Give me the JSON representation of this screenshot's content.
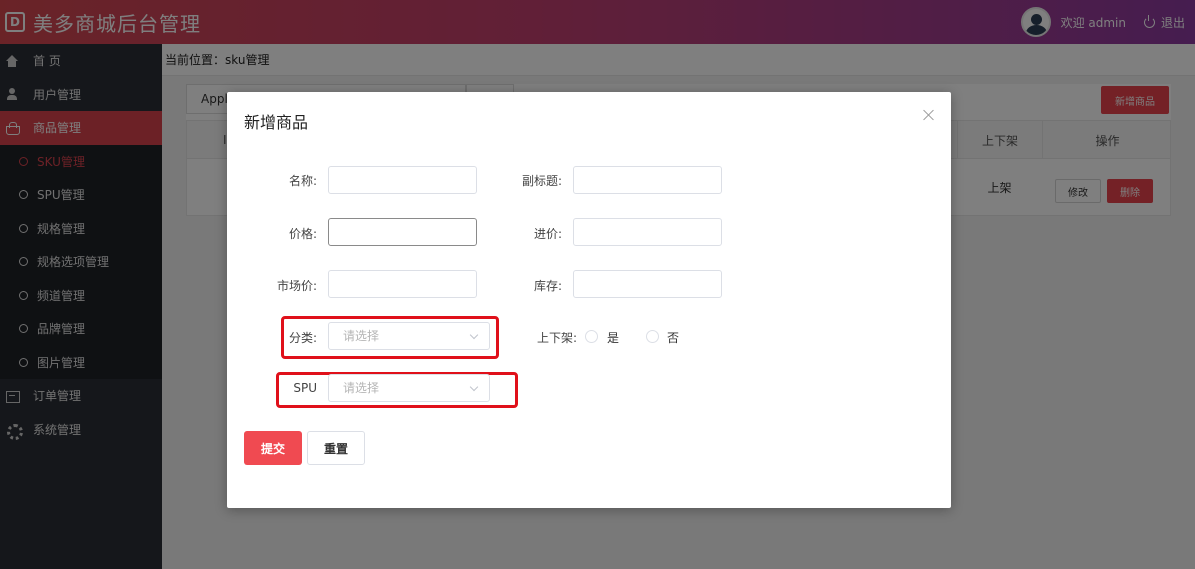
{
  "header": {
    "logo_glyph": "D",
    "title": "美多商城后台管理",
    "welcome": "欢迎 admin",
    "logout": "退出"
  },
  "sidebar": {
    "items": [
      {
        "label": "首 页",
        "icon": "home-icon"
      },
      {
        "label": "用户管理",
        "icon": "user-icon"
      },
      {
        "label": "商品管理",
        "icon": "basket-icon"
      },
      {
        "label": "订单管理",
        "icon": "list-icon"
      },
      {
        "label": "系统管理",
        "icon": "gear-icon"
      }
    ],
    "sub_items": [
      {
        "label": "SKU管理"
      },
      {
        "label": "SPU管理"
      },
      {
        "label": "规格管理"
      },
      {
        "label": "规格选项管理"
      },
      {
        "label": "频道管理"
      },
      {
        "label": "品牌管理"
      },
      {
        "label": "图片管理"
      }
    ]
  },
  "main": {
    "breadcrumb": "当前位置：sku管理",
    "search_value": "Apple",
    "new_button": "新增商品",
    "table": {
      "headers": {
        "status": "上下架",
        "operation": "操作"
      },
      "rows": [
        {
          "status": "上架",
          "edit": "修改",
          "delete": "删除"
        }
      ]
    }
  },
  "dialog": {
    "title": "新增商品",
    "fields": {
      "name_label": "名称:",
      "subtitle_label": "副标题:",
      "price_label": "价格:",
      "cost_label": "进价:",
      "market_label": "市场价:",
      "stock_label": "库存:",
      "category_label": "分类:",
      "category_placeholder": "请选择",
      "onsale_label": "上下架:",
      "onsale_yes": "是",
      "onsale_no": "否",
      "spu_label": "SPU",
      "spu_placeholder": "请选择"
    },
    "submit": "提交",
    "reset": "重置"
  },
  "colors": {
    "accent": "#e8434c",
    "highlight": "#e0101a",
    "sidebar_bg": "#2b2f36"
  }
}
